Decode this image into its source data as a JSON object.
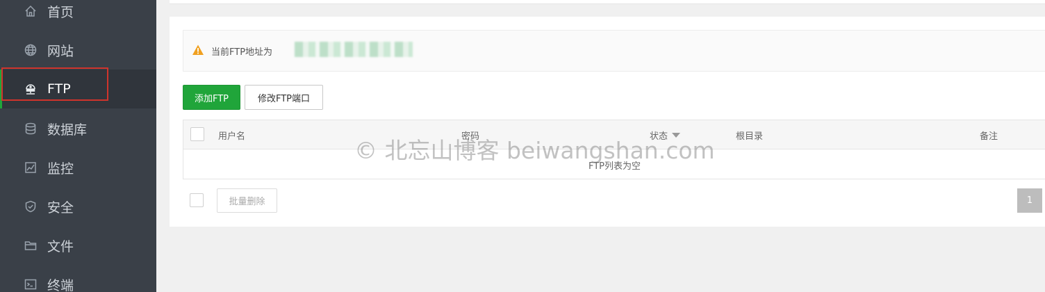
{
  "sidebar": {
    "items": [
      {
        "label": "首页",
        "icon": "home-icon"
      },
      {
        "label": "网站",
        "icon": "globe-icon"
      },
      {
        "label": "FTP",
        "icon": "ftp-network-icon",
        "active": true
      },
      {
        "label": "数据库",
        "icon": "database-icon"
      },
      {
        "label": "监控",
        "icon": "monitor-chart-icon"
      },
      {
        "label": "安全",
        "icon": "shield-icon"
      },
      {
        "label": "文件",
        "icon": "folder-icon"
      },
      {
        "label": "终端",
        "icon": "terminal-icon"
      }
    ]
  },
  "notice": {
    "text": "当前FTP地址为"
  },
  "toolbar": {
    "add_label": "添加FTP",
    "port_label": "修改FTP端口"
  },
  "table": {
    "columns": [
      "用户名",
      "密码",
      "状态",
      "根目录",
      "备注"
    ],
    "empty_text": "FTP列表为空"
  },
  "footer": {
    "batch_delete_label": "批量删除",
    "current_page": "1"
  },
  "watermark": "© 北忘山博客 beiwangshan.com",
  "colors": {
    "accent": "#20a53a",
    "sidebar_bg": "#3a4048",
    "highlight": "#d0342c",
    "warning": "#f0a020"
  }
}
